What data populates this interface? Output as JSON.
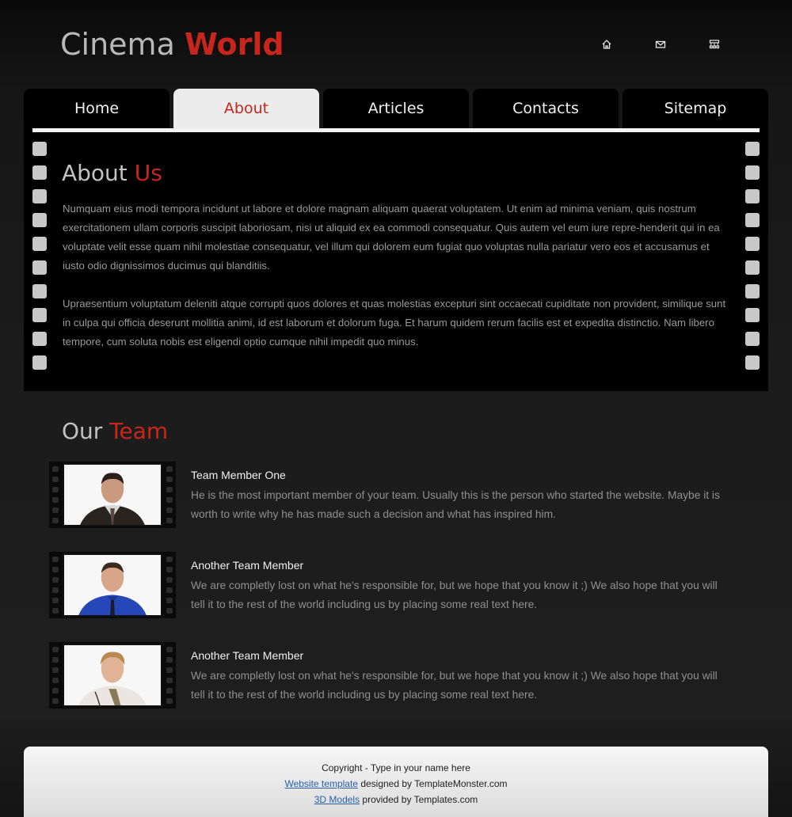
{
  "brand": {
    "word1": "Cinema",
    "word2": "World"
  },
  "top_icons": [
    "home-icon",
    "mail-icon",
    "sitemap-icon"
  ],
  "nav": {
    "tabs": [
      {
        "label": "Home",
        "active": false
      },
      {
        "label": "About",
        "active": true
      },
      {
        "label": "Articles",
        "active": false
      },
      {
        "label": "Contacts",
        "active": false
      },
      {
        "label": "Sitemap",
        "active": false
      }
    ]
  },
  "about": {
    "title_word1": "About",
    "title_word2": "Us",
    "paragraph1": "Numquam eius modi tempora incidunt ut labore et dolore magnam aliquam quaerat voluptatem. Ut enim ad minima veniam, quis nostrum exercitationem ullam corporis suscipit laboriosam, nisi ut aliquid ex ea commodi consequatur. Quis autem vel eum iure repre-henderit qui in ea voluptate velit esse quam nihil molestiae consequatur, vel illum qui dolorem eum fugiat quo voluptas nulla pariatur vero eos et accusamus et iusto odio dignissimos ducimus qui blanditiis.",
    "paragraph2": "Upraesentium voluptatum deleniti atque corrupti quos dolores et quas molestias excepturi sint occaecati cupiditate non provident, similique sunt in culpa qui officia deserunt mollitia animi, id est laborum et dolorum fuga. Et harum quidem rerum facilis est et expedita distinctio. Nam libero tempore, cum soluta nobis est eligendi optio cumque nihil impedit quo minus."
  },
  "team": {
    "title_word1": "Our",
    "title_word2": "Team",
    "members": [
      {
        "name": "Team Member One",
        "description": "He is the most important member of your team. Usually this is the person who started the website. Maybe it is worth to write why he has made such a decision and what has inspired him."
      },
      {
        "name": "Another Team Member",
        "description": "We are completly lost on what he's responsible for, but we hope that you know it ;) We also hope that you will tell it to the rest of the world including us by placing some real text here."
      },
      {
        "name": "Another Team Member",
        "description": "We are completly lost on what he's responsible for, but we hope that you know it ;) We also hope that you will tell it to the rest of the world including us by placing some real text here."
      }
    ]
  },
  "footer": {
    "copyright": "Copyright - Type in your name here",
    "link1": "Website template",
    "text1": "designed by TemplateMonster.com",
    "link2": "3D Models",
    "text2": "provided by Templates.com"
  },
  "colors": {
    "accent": "#c8261d",
    "panel": "#000000",
    "background": "#1c1c1c",
    "link": "#2a5fa8"
  }
}
